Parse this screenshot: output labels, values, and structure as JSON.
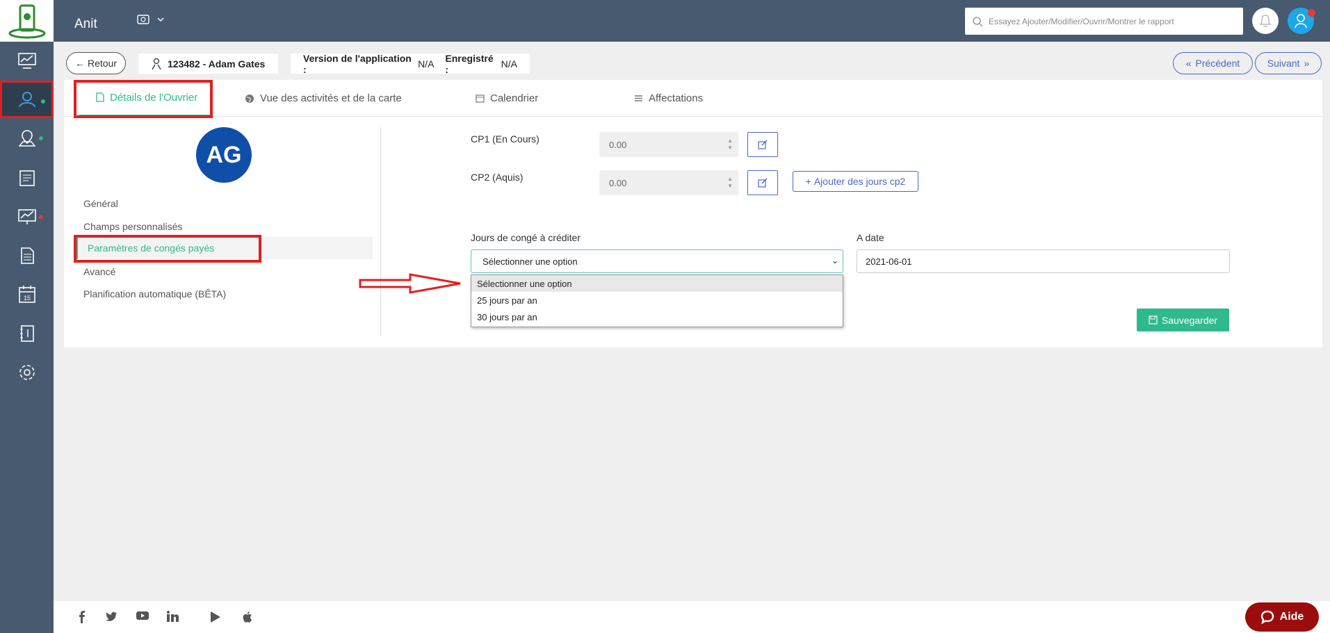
{
  "header": {
    "app_title": "Anit",
    "currency_icon": "currency-icon",
    "search_placeholder": "Essayez Ajouter/Modifier/Ouvrir/Montrer le rapport"
  },
  "sidebar": {
    "items": [
      {
        "name": "dashboard-icon"
      },
      {
        "name": "workers-icon",
        "active": true,
        "dot_color": "#2fb98d"
      },
      {
        "name": "map-user-icon",
        "dot_color": "#2fb98d"
      },
      {
        "name": "report-icon"
      },
      {
        "name": "analytics-icon",
        "dot_color": "#e53935"
      },
      {
        "name": "document-icon"
      },
      {
        "name": "calendar-icon",
        "label": "15"
      },
      {
        "name": "notebook-icon"
      },
      {
        "name": "settings-icon"
      }
    ]
  },
  "infobar": {
    "back_label": "Retour",
    "worker": "123482 - Adam Gates",
    "version_label": "Version de l'application :",
    "version_value": "N/A",
    "saved_label": "Enregistré :",
    "saved_value": "N/A",
    "prev_label": "Précédent",
    "next_label": "Suivant"
  },
  "tabs": [
    {
      "label": "Détails de l'Ouvrier",
      "active": true
    },
    {
      "label": "Vue des activités et de la carte"
    },
    {
      "label": "Calendrier"
    },
    {
      "label": "Affectations"
    }
  ],
  "profile": {
    "initials": "AG"
  },
  "side_menu": [
    "Général",
    "Champs personnalisés",
    "Paramètres de congés payés",
    "Avancé",
    "Planification automatique (BÊTA)"
  ],
  "form": {
    "cp1_label": "CP1 (En Cours)",
    "cp1_value": "0.00",
    "cp2_label": "CP2 (Aquis)",
    "cp2_value": "0.00",
    "add_cp2_label": "Ajouter des jours cp2",
    "jours_label": "Jours de congé à créditer",
    "jours_selected": "Sélectionner une option",
    "jours_options": [
      "Sélectionner une option",
      "25 jours par an",
      "30 jours par an"
    ],
    "date_label": "A date",
    "date_value": "2021-06-01",
    "save_label": "Sauvegarder"
  },
  "footer": {
    "social": [
      "facebook-icon",
      "twitter-icon",
      "youtube-icon",
      "linkedin-icon",
      "play-store-icon",
      "apple-icon"
    ],
    "help_label": "Aide"
  },
  "colors": {
    "sidebar": "#475a6f",
    "accent": "#2fb98d",
    "link": "#4a68c9",
    "annotation": "#e02020",
    "avatar": "#0f4fa8",
    "help": "#9b0d0d"
  }
}
